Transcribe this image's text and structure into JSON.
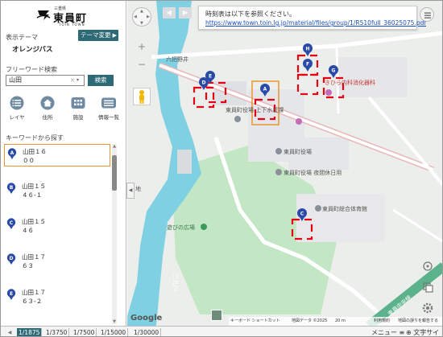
{
  "header": {
    "logo_small": "三重県",
    "logo_name": "東員町",
    "logo_roman": "TOIN TOWN"
  },
  "theme": {
    "label": "表示テーマ",
    "name": "オレンジバス",
    "change_button": "テーマ変更",
    "change_arrow": "▶"
  },
  "search": {
    "label": "フリーワード検索",
    "value": "山田",
    "clear_glyph": "×",
    "dropdown_glyph": "▾",
    "button": "検索"
  },
  "tools": [
    {
      "label": "レイヤ",
      "icon": "layers-icon"
    },
    {
      "label": "住所",
      "icon": "house-icon"
    },
    {
      "label": "施設",
      "icon": "building-icon"
    },
    {
      "label": "情報一覧",
      "icon": "list-icon"
    }
  ],
  "keyword_list": {
    "heading": "キーワードから探す",
    "items": [
      {
        "letter": "A",
        "line1": "山田１６",
        "line2": "００",
        "selected": true
      },
      {
        "letter": "B",
        "line1": "山田１５",
        "line2": "４６-１",
        "selected": false
      },
      {
        "letter": "C",
        "line1": "山田１５",
        "line2": "４６",
        "selected": false
      },
      {
        "letter": "D",
        "line1": "山田１７",
        "line2": "６３",
        "selected": false
      },
      {
        "letter": "E",
        "line1": "山田１７",
        "line2": "６３-２",
        "selected": false
      }
    ],
    "scroll_up": "▲",
    "scroll_down": "▼",
    "collapse_glyph": "◀"
  },
  "map": {
    "popup_line1": "時刻表は以下を参照ください。",
    "popup_link": "https://www.town.toin.lg.jp/material/files/group/1/R510full_36025075.pdf",
    "labels": {
      "road_1": "六把野井",
      "facility_1": "東員町役場 上下水道課",
      "facility_2": "東員町役場",
      "facility_3": "東員町役場 夜間休日用",
      "facility_4": "東員町総合体育館",
      "facility_5": "遊びの広場",
      "clinic": "きひら内科消化器科",
      "river": "三孔川",
      "road_2": "東員中央線",
      "edge_char": "地"
    },
    "markers": [
      "A",
      "B",
      "C",
      "D",
      "E",
      "F",
      "G",
      "H"
    ],
    "zoom_in": "+",
    "zoom_out": "−",
    "back": "◀",
    "forward": "▶",
    "google": "Google",
    "attribution": {
      "shortcuts": "キーボード ショートカット",
      "mapdata": "地図データ ©2025",
      "scale": "20 m",
      "terms": "利用規約",
      "report": "地図の誤りを報告する"
    }
  },
  "bottom": {
    "first_glyph": "◀",
    "scales": [
      "1/1875",
      "1/3750",
      "1/7500",
      "1/15000",
      "1/30000"
    ],
    "selected_scale": "1/1875",
    "menu": "メニュー",
    "menu_glyph": "≡",
    "font_size": "文字サイズ",
    "font_glyph": "⊕"
  },
  "colors": {
    "accent": "#2d6a76",
    "selected_border": "#e8962c",
    "marker_blue": "#2a4aa8",
    "marker_red": "#e60012",
    "water": "#7ed0e2",
    "park": "#c3e6c4"
  }
}
